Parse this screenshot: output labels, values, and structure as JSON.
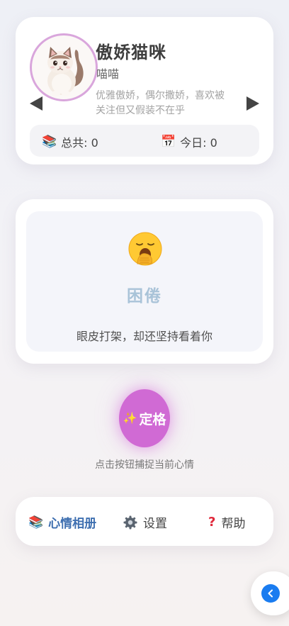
{
  "profile": {
    "name": "傲娇猫咪",
    "subname": "喵喵",
    "description": "优雅傲娇，偶尔撒娇，喜欢被关注但又假装不在乎",
    "stats": {
      "total_icon": "books-icon",
      "total_label": "总共: 0",
      "today_icon": "calendar-icon",
      "today_label": "今日: 0"
    },
    "avatar_border_color": "#d9a6dc"
  },
  "mood": {
    "face_icon": "yawning-face-icon",
    "title": "困倦",
    "text": "眼皮打架，却还坚持看着你",
    "title_color": "#a9c3d8"
  },
  "capture": {
    "icon": "sparkles-icon",
    "label": "定格",
    "hint": "点击按钮捕捉当前心情",
    "color": "#d06ad4"
  },
  "nav": {
    "album_label": "心情相册",
    "settings_label": "设置",
    "help_label": "帮助",
    "active_color": "#3e6fb0"
  },
  "fab": {
    "icon": "chevron-left-icon",
    "color": "#1a7cf0"
  }
}
